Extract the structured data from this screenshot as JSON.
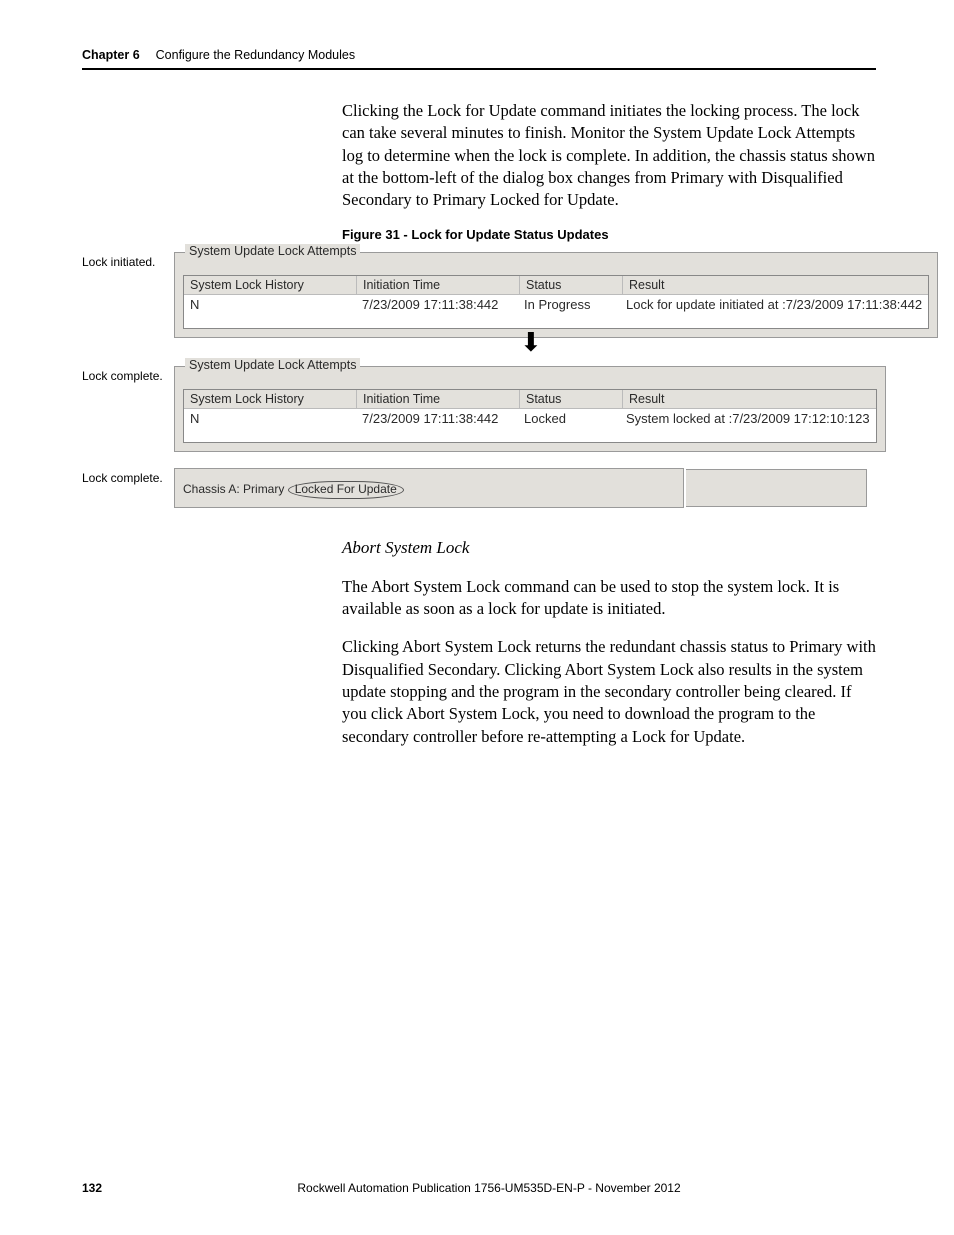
{
  "header": {
    "chapter_label": "Chapter 6",
    "chapter_title": "Configure the Redundancy Modules"
  },
  "intro_paragraph": "Clicking the Lock for Update command initiates the locking process. The lock can take several minutes to finish. Monitor the System Update Lock Attempts log to determine when the lock is complete. In addition, the chassis status shown at the bottom-left of the dialog box changes from Primary with Disqualified Secondary to Primary Locked for Update.",
  "figure_caption": "Figure 31 - Lock for Update Status Updates",
  "side_labels": {
    "initiated": "Lock initiated.",
    "complete1": "Lock complete.",
    "complete2": "Lock complete."
  },
  "groupbox_legend": "System Update Lock Attempts",
  "columns": {
    "history": "System Lock History",
    "time": "Initiation Time",
    "status": "Status",
    "result": "Result"
  },
  "row_initiated": {
    "history": "N",
    "time": "7/23/2009 17:11:38:442",
    "status": "In Progress",
    "result": "Lock for update initiated at :7/23/2009 17:11:38:442"
  },
  "row_complete": {
    "history": "N",
    "time": "7/23/2009 17:11:38:442",
    "status": "Locked",
    "result": "System locked at :7/23/2009 17:12:10:123"
  },
  "status_bar_prefix": "Chassis A: Primary",
  "status_bar_circled": "Locked For Update",
  "abort": {
    "title": "Abort System Lock",
    "p1": "The Abort System Lock command can be used to stop the system lock. It is available as soon as a lock for update is initiated.",
    "p2": "Clicking Abort System Lock returns the redundant chassis status to Primary with Disqualified Secondary. Clicking Abort System Lock also results in the system update stopping and the program in the secondary controller being cleared. If you click Abort System Lock, you need to download the program to the secondary controller before re-attempting a Lock for Update."
  },
  "footer": {
    "page_number": "132",
    "publication": "Rockwell Automation Publication 1756-UM535D-EN-P - November 2012"
  }
}
